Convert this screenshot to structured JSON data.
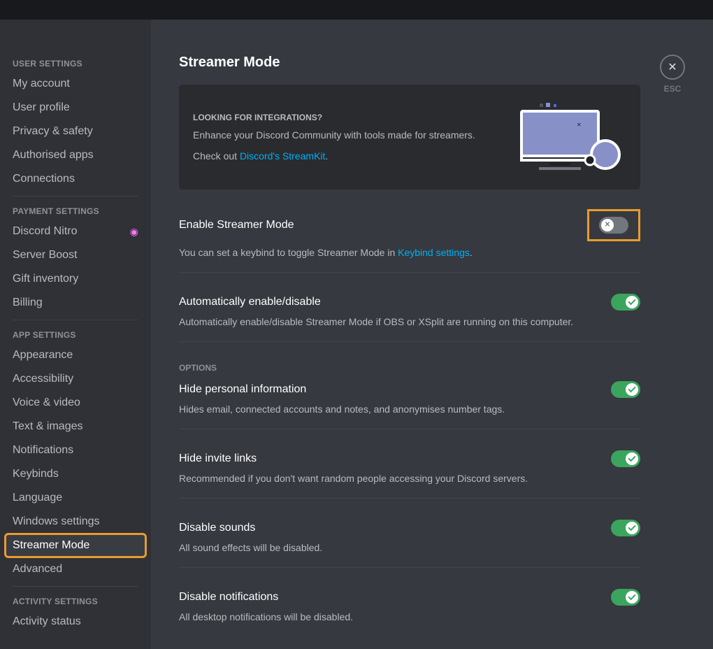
{
  "sidebar": {
    "sections": [
      {
        "header": "USER SETTINGS",
        "items": [
          {
            "label": "My account",
            "name": "sidebar-item-my-account"
          },
          {
            "label": "User profile",
            "name": "sidebar-item-user-profile"
          },
          {
            "label": "Privacy & safety",
            "name": "sidebar-item-privacy-safety"
          },
          {
            "label": "Authorised apps",
            "name": "sidebar-item-authorised-apps"
          },
          {
            "label": "Connections",
            "name": "sidebar-item-connections"
          }
        ]
      },
      {
        "header": "PAYMENT SETTINGS",
        "items": [
          {
            "label": "Discord Nitro",
            "name": "sidebar-item-discord-nitro",
            "nitro": true
          },
          {
            "label": "Server Boost",
            "name": "sidebar-item-server-boost"
          },
          {
            "label": "Gift inventory",
            "name": "sidebar-item-gift-inventory"
          },
          {
            "label": "Billing",
            "name": "sidebar-item-billing"
          }
        ]
      },
      {
        "header": "APP SETTINGS",
        "items": [
          {
            "label": "Appearance",
            "name": "sidebar-item-appearance"
          },
          {
            "label": "Accessibility",
            "name": "sidebar-item-accessibility"
          },
          {
            "label": "Voice & video",
            "name": "sidebar-item-voice-video"
          },
          {
            "label": "Text & images",
            "name": "sidebar-item-text-images"
          },
          {
            "label": "Notifications",
            "name": "sidebar-item-notifications"
          },
          {
            "label": "Keybinds",
            "name": "sidebar-item-keybinds"
          },
          {
            "label": "Language",
            "name": "sidebar-item-language"
          },
          {
            "label": "Windows settings",
            "name": "sidebar-item-windows-settings"
          },
          {
            "label": "Streamer Mode",
            "name": "sidebar-item-streamer-mode",
            "active": true,
            "highlight": true
          },
          {
            "label": "Advanced",
            "name": "sidebar-item-advanced"
          }
        ]
      },
      {
        "header": "ACTIVITY SETTINGS",
        "items": [
          {
            "label": "Activity status",
            "name": "sidebar-item-activity-status"
          }
        ]
      }
    ]
  },
  "page": {
    "title": "Streamer Mode",
    "close_label": "ESC"
  },
  "promo": {
    "heading": "LOOKING FOR INTEGRATIONS?",
    "desc": "Enhance your Discord Community with tools made for streamers.",
    "checkout_prefix": "Check out ",
    "link_text": "Discord's StreamKit",
    "checkout_suffix": "."
  },
  "settings": {
    "enable": {
      "title": "Enable Streamer Mode",
      "desc_prefix": "You can set a keybind to toggle Streamer Mode in ",
      "desc_link": "Keybind settings",
      "desc_suffix": ".",
      "on": false,
      "highlight": true
    },
    "auto": {
      "title": "Automatically enable/disable",
      "desc": "Automatically enable/disable Streamer Mode if OBS or XSplit are running on this computer.",
      "on": true
    },
    "options_header": "OPTIONS",
    "options": [
      {
        "title": "Hide personal information",
        "desc": "Hides email, connected accounts and notes, and anonymises number tags.",
        "on": true,
        "name": "hide-personal-info"
      },
      {
        "title": "Hide invite links",
        "desc": "Recommended if you don't want random people accessing your Discord servers.",
        "on": true,
        "name": "hide-invite-links"
      },
      {
        "title": "Disable sounds",
        "desc": "All sound effects will be disabled.",
        "on": true,
        "name": "disable-sounds"
      },
      {
        "title": "Disable notifications",
        "desc": "All desktop notifications will be disabled.",
        "on": true,
        "name": "disable-notifications"
      }
    ]
  }
}
